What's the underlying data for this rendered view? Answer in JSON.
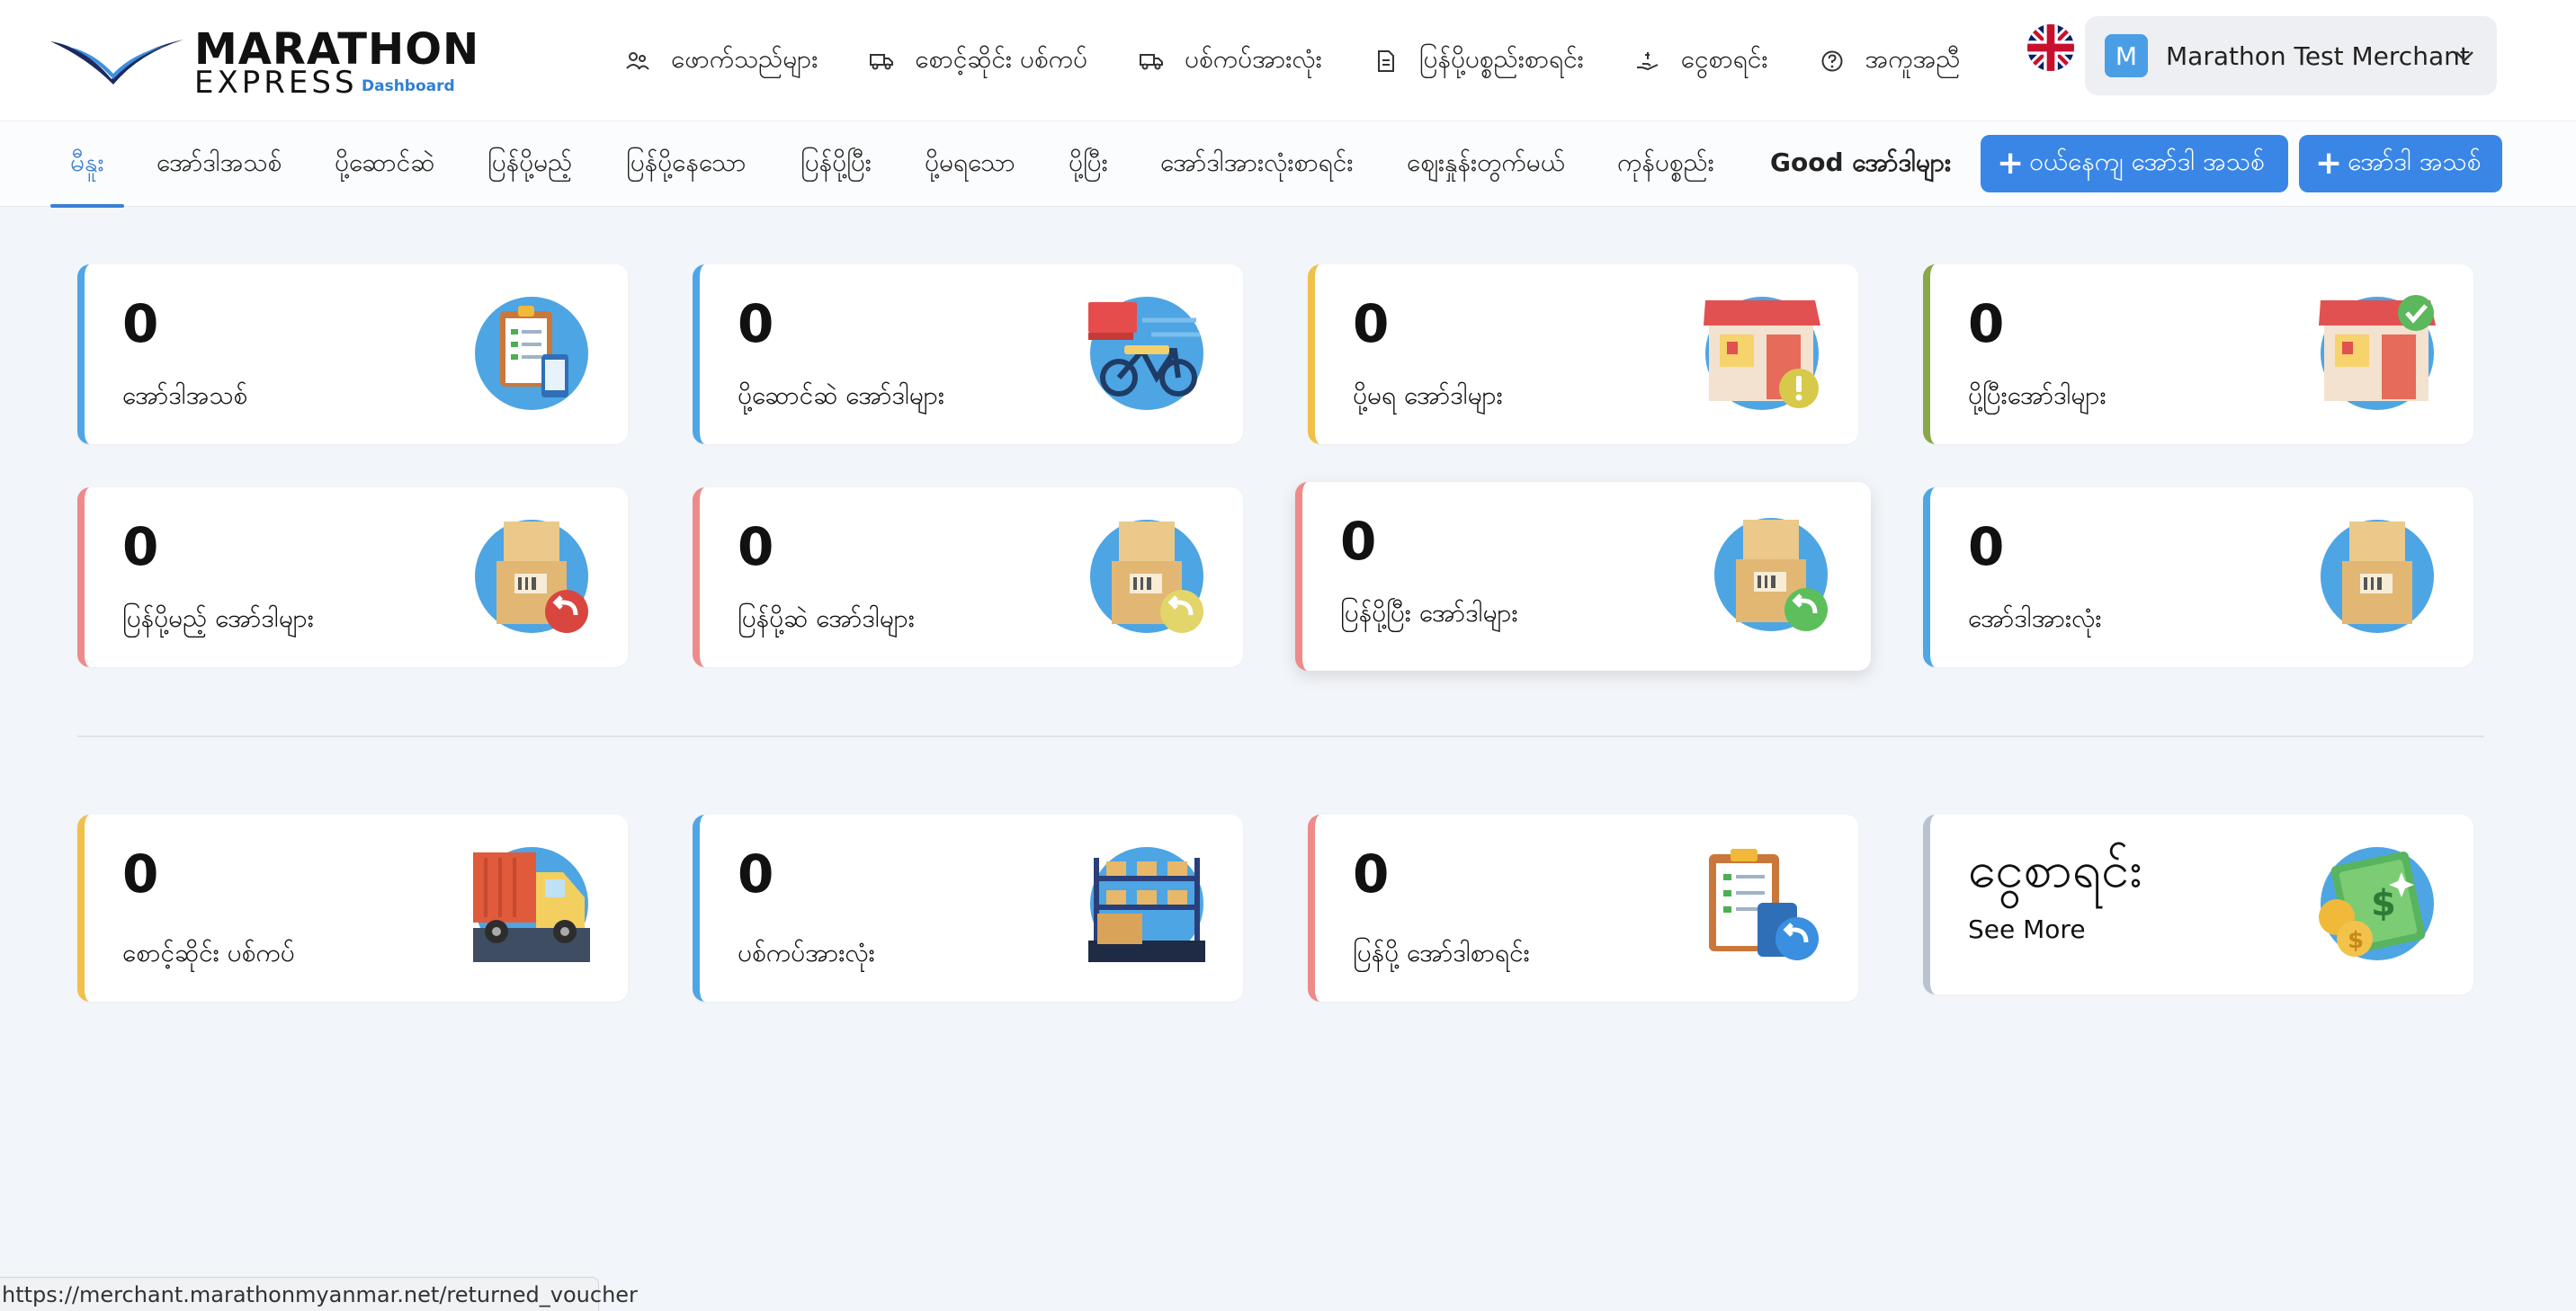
{
  "brand": {
    "name_line1": "MARATHON",
    "name_line2": "EXPRESS",
    "tagline": "Dashboard",
    "color": "#2f7fd6"
  },
  "topnav": [
    {
      "icon": "users-icon",
      "label": "ဖောက်သည်များ"
    },
    {
      "icon": "truck-icon",
      "label": "စောင့်ဆိုင်း ပစ်ကပ်"
    },
    {
      "icon": "truck-icon",
      "label": "ပစ်ကပ်အားလုံး"
    },
    {
      "icon": "document-icon",
      "label": "ပြန်ပို့ပစ္စည်းစာရင်း"
    },
    {
      "icon": "hand-money-icon",
      "label": "ငွေစာရင်း"
    },
    {
      "icon": "help-circle-icon",
      "label": "အကူအညီ"
    }
  ],
  "language": {
    "icon": "uk-flag-icon"
  },
  "account": {
    "initial": "M",
    "name": "Marathon Test Merchant"
  },
  "tabs": [
    {
      "label": "မီနူး",
      "active": true
    },
    {
      "label": "အော်ဒါအသစ်"
    },
    {
      "label": "ပို့ဆောင်ဆဲ"
    },
    {
      "label": "ပြန်ပို့မည့်"
    },
    {
      "label": "ပြန်ပို့နေသော"
    },
    {
      "label": "ပြန်ပို့ပြီး"
    },
    {
      "label": "ပို့မရသော"
    },
    {
      "label": "ပို့ပြီး"
    },
    {
      "label": "အော်ဒါအားလုံးစာရင်း"
    },
    {
      "label": "ဈေးနှုန်းတွက်မယ်"
    },
    {
      "label": "ကုန်ပစ္စည်း"
    },
    {
      "label": "Good အော်ဒါများ",
      "bold": true
    }
  ],
  "actions": {
    "web_order": "ဝယ်နေကျ အော်ဒါ အသစ်",
    "new_order": "အော်ဒါ အသစ်"
  },
  "colors": {
    "blue": "#4fa6e6",
    "yellow": "#f0c04a",
    "green": "#8aa84a",
    "red": "#ef8a8a",
    "grey": "#b9c3d0",
    "accent": "#3a86e6"
  },
  "cards_row1": [
    {
      "value": "0",
      "label": "အော်ဒါအသစ်",
      "accent": "blue",
      "icon": "clipboard-phone-icon"
    },
    {
      "value": "0",
      "label": "ပို့ဆောင်ဆဲ အော်ဒါများ",
      "accent": "blue",
      "icon": "delivery-bike-icon"
    },
    {
      "value": "0",
      "label": "ပို့မရ အော်ဒါများ",
      "accent": "yellow",
      "icon": "store-warning-icon"
    },
    {
      "value": "0",
      "label": "ပို့ပြီးအော်ဒါများ",
      "accent": "green",
      "icon": "store-check-icon"
    }
  ],
  "cards_row2": [
    {
      "value": "0",
      "label": "ပြန်ပို့မည့် အော်ဒါများ",
      "accent": "red",
      "icon": "box-return-red-icon"
    },
    {
      "value": "0",
      "label": "ပြန်ပို့ဆဲ အော်ဒါများ",
      "accent": "red",
      "icon": "box-return-yellow-icon"
    },
    {
      "value": "0",
      "label": "ပြန်ပို့ပြီး အော်ဒါများ",
      "accent": "red",
      "icon": "box-return-green-icon"
    },
    {
      "value": "0",
      "label": "အော်ဒါအားလုံး",
      "accent": "blue",
      "icon": "boxes-icon"
    }
  ],
  "cards_row3": [
    {
      "value": "0",
      "label": "စောင့်ဆိုင်း ပစ်ကပ်",
      "accent": "yellow",
      "icon": "pickup-truck-icon"
    },
    {
      "value": "0",
      "label": "ပစ်ကပ်အားလုံး",
      "accent": "blue",
      "icon": "warehouse-shelves-icon"
    },
    {
      "value": "0",
      "label": "ပြန်ပို့ အော်ဒါစာရင်း",
      "accent": "red",
      "icon": "clipboard-return-icon"
    },
    {
      "value": "ငွေစာရင်း",
      "label": "See More",
      "accent": "grey",
      "icon": "money-coins-icon"
    }
  ],
  "statusbar": {
    "url": "https://merchant.marathonmyanmar.net/returned_voucher"
  }
}
